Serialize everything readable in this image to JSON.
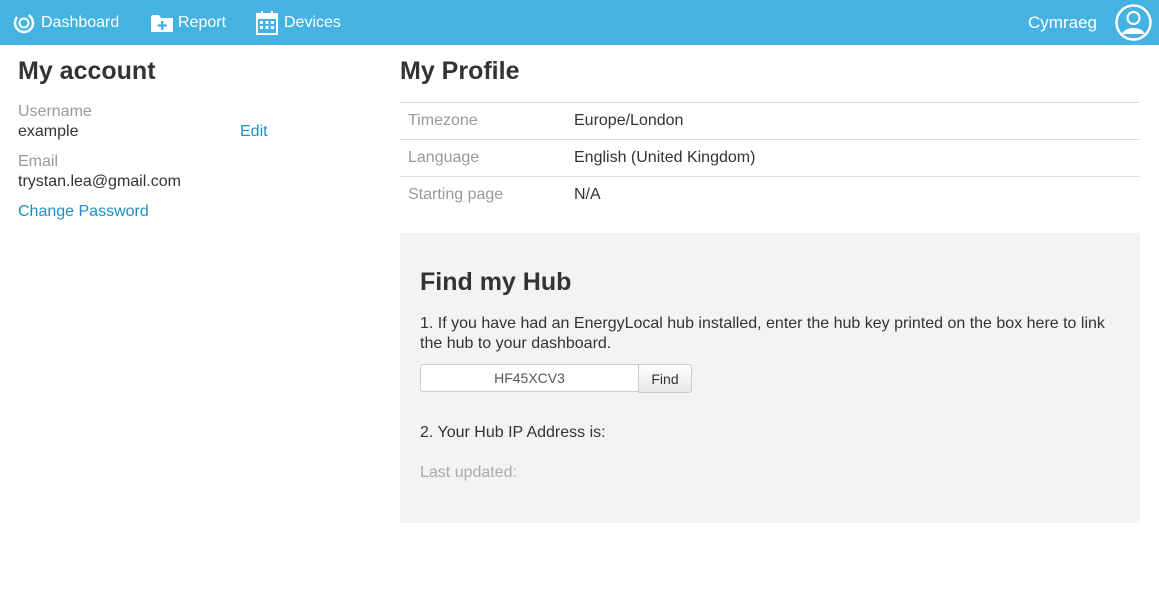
{
  "nav": {
    "dashboard_label": "Dashboard",
    "report_label": "Report",
    "devices_label": "Devices",
    "language_label": "Cymraeg",
    "brand_color": "#44b3e2"
  },
  "account": {
    "title": "My account",
    "username_label": "Username",
    "username_value": "example",
    "edit_label": "Edit",
    "email_label": "Email",
    "email_value": "trystan.lea@gmail.com",
    "change_password_label": "Change Password"
  },
  "profile": {
    "title": "My Profile",
    "rows": [
      {
        "key": "Timezone",
        "value": "Europe/London"
      },
      {
        "key": "Language",
        "value": "English (United Kingdom)"
      },
      {
        "key": "Starting page",
        "value": "N/A"
      }
    ]
  },
  "hub": {
    "title": "Find my Hub",
    "step1_text": "1. If you have had an EnergyLocal hub installed, enter the hub key printed on the box here to link the hub to your dashboard.",
    "input_value": "HF45XCV3",
    "find_label": "Find",
    "step2_text": "2. Your Hub IP Address is:",
    "last_updated_label": "Last updated:"
  }
}
